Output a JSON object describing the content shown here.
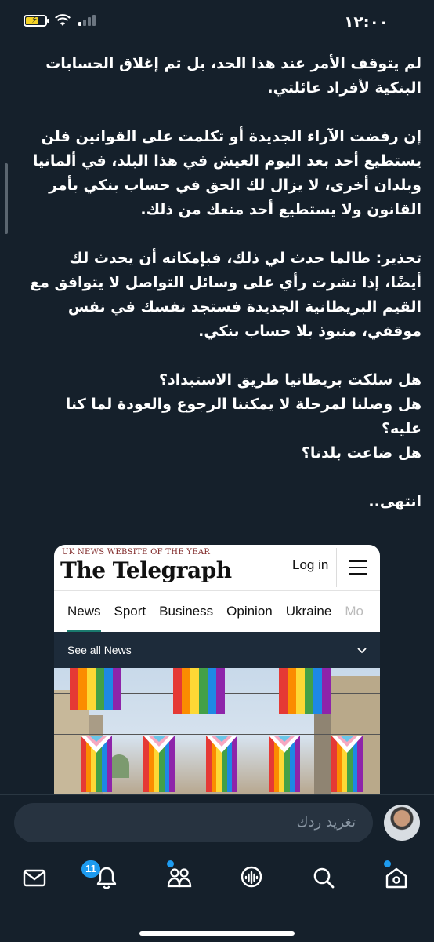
{
  "status_bar": {
    "time": "١٢:٠٠"
  },
  "tweet": {
    "paragraphs": [
      "لم يتوقف الأمر عند هذا الحد، بل تم إغلاق الحسابات البنكية لأفراد عائلتي.",
      "إن رفضت الآراء الجديدة أو تكلمت على القوانين فلن يستطيع أحد بعد اليوم العيش في هذا البلد، في ألمانيا وبلدان أخرى، لا يزال لك الحق في حساب بنكي بأمر القانون ولا يستطيع أحد منعك من ذلك.",
      "تحذير: طالما حدث لي ذلك، فبإمكانه أن يحدث لك أيضًا، إذا نشرت رأي على وسائل التواصل لا يتوافق مع القيم البريطانية الجديدة فستجد نفسك في نفس موقفي، منبوذ بلا حساب بنكي.",
      "هل سلكت بريطانيا طريق الاستبداد؟\nهل وصلنا لمرحلة لا يمكننا الرجوع والعودة لما كنا عليه؟\nهل ضاعت بلدنا؟",
      "انتهى.."
    ]
  },
  "card": {
    "tagline": "UK NEWS WEBSITE OF THE YEAR",
    "masthead": "The Telegraph",
    "login": "Log in",
    "nav": [
      "News",
      "Sport",
      "Business",
      "Opinion",
      "Ukraine",
      "Mo"
    ],
    "see_all": "See all News"
  },
  "reply": {
    "placeholder": "تغريد ردك"
  },
  "bottom_nav": {
    "notifications_badge": "11",
    "items": [
      "mail-icon",
      "bell-icon",
      "communities-icon",
      "spaces-icon",
      "search-icon",
      "home-icon"
    ]
  },
  "colors": {
    "background": "#15202b",
    "accent": "#1d9bf0",
    "telegraph_accent": "#1a7a6e"
  }
}
